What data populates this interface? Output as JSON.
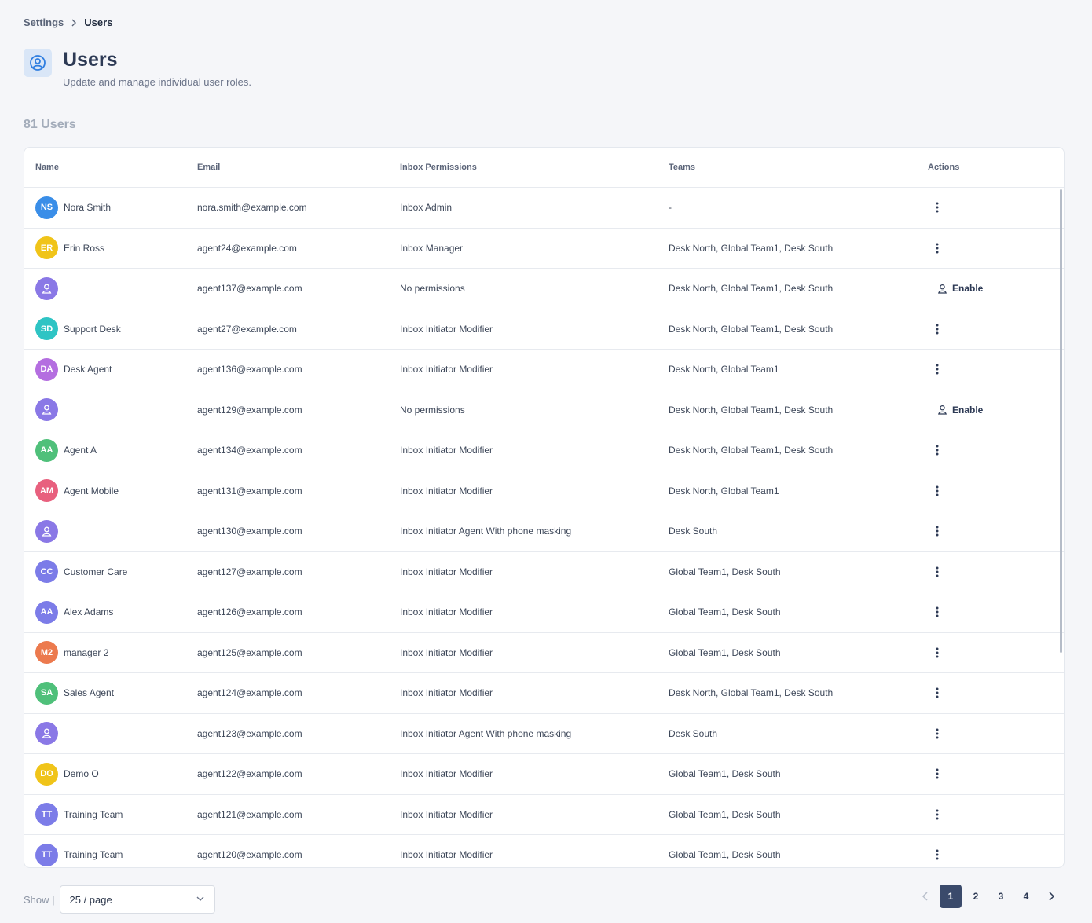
{
  "breadcrumb": {
    "parent": "Settings",
    "current": "Users"
  },
  "header": {
    "title": "Users",
    "subtitle": "Update and manage individual user roles."
  },
  "user_count": "81 Users",
  "columns": {
    "name": "Name",
    "email": "Email",
    "permissions": "Inbox Permissions",
    "teams": "Teams",
    "actions": "Actions"
  },
  "enable_label": "Enable",
  "rows": [
    {
      "initials": "NS",
      "color": "#3a8ee8",
      "name": "Nora Smith",
      "email": "nora.smith@example.com",
      "permission": "Inbox Admin",
      "teams": "-",
      "action": "menu"
    },
    {
      "initials": "ER",
      "color": "#f0c419",
      "name": "Erin Ross",
      "email": "agent24@example.com",
      "permission": "Inbox Manager",
      "teams": "Desk North,  Global Team1,  Desk South",
      "action": "menu"
    },
    {
      "initials": "",
      "color": "#8a78e6",
      "name": "",
      "email": "agent137@example.com",
      "permission": "No permissions",
      "teams": "Desk North,  Global Team1,  Desk South",
      "action": "enable"
    },
    {
      "initials": "SD",
      "color": "#2ec4c4",
      "name": "Support Desk",
      "email": "agent27@example.com",
      "permission": "Inbox Initiator Modifier",
      "teams": "Desk North,  Global Team1,  Desk South",
      "action": "menu"
    },
    {
      "initials": "DA",
      "color": "#b46ee0",
      "name": "Desk Agent",
      "email": "agent136@example.com",
      "permission": "Inbox Initiator Modifier",
      "teams": "Desk North,  Global Team1",
      "action": "menu"
    },
    {
      "initials": "",
      "color": "#8a78e6",
      "name": "",
      "email": "agent129@example.com",
      "permission": "No permissions",
      "teams": "Desk North,  Global Team1,  Desk South",
      "action": "enable"
    },
    {
      "initials": "AA",
      "color": "#4fc07a",
      "name": "Agent A",
      "email": "agent134@example.com",
      "permission": "Inbox Initiator Modifier",
      "teams": "Desk North,  Global Team1,  Desk South",
      "action": "menu"
    },
    {
      "initials": "AM",
      "color": "#e8607e",
      "name": "Agent Mobile",
      "email": "agent131@example.com",
      "permission": "Inbox Initiator Modifier",
      "teams": "Desk North,  Global Team1",
      "action": "menu"
    },
    {
      "initials": "",
      "color": "#8a78e6",
      "name": "",
      "email": "agent130@example.com",
      "permission": "Inbox Initiator Agent With phone masking",
      "teams": "Desk South",
      "action": "menu"
    },
    {
      "initials": "CC",
      "color": "#7c7ce8",
      "name": "Customer Care",
      "email": "agent127@example.com",
      "permission": "Inbox Initiator Modifier",
      "teams": "Global Team1,  Desk South",
      "action": "menu"
    },
    {
      "initials": "AA",
      "color": "#7c7ce8",
      "name": "Alex Adams",
      "email": "agent126@example.com",
      "permission": "Inbox Initiator Modifier",
      "teams": "Global Team1,  Desk South",
      "action": "menu"
    },
    {
      "initials": "M2",
      "color": "#ec7a4e",
      "name": "manager 2",
      "email": "agent125@example.com",
      "permission": "Inbox Initiator Modifier",
      "teams": "Global Team1,  Desk South",
      "action": "menu"
    },
    {
      "initials": "SA",
      "color": "#4fc07a",
      "name": "Sales Agent",
      "email": "agent124@example.com",
      "permission": "Inbox Initiator Modifier",
      "teams": "Desk North,  Global Team1,  Desk South",
      "action": "menu"
    },
    {
      "initials": "",
      "color": "#8a78e6",
      "name": "",
      "email": "agent123@example.com",
      "permission": "Inbox Initiator Agent With phone masking",
      "teams": "Desk South",
      "action": "menu"
    },
    {
      "initials": "DO",
      "color": "#f0c419",
      "name": "Demo O",
      "email": "agent122@example.com",
      "permission": "Inbox Initiator Modifier",
      "teams": "Global Team1,  Desk South",
      "action": "menu"
    },
    {
      "initials": "TT",
      "color": "#7c7ce8",
      "name": "Training Team",
      "email": "agent121@example.com",
      "permission": "Inbox Initiator Modifier",
      "teams": "Global Team1,  Desk South",
      "action": "menu"
    },
    {
      "initials": "TT",
      "color": "#7c7ce8",
      "name": "Training Team",
      "email": "agent120@example.com",
      "permission": "Inbox Initiator Modifier",
      "teams": "Global Team1,  Desk South",
      "action": "menu"
    }
  ],
  "footer": {
    "show_label": "Show |",
    "page_size": "25 / page",
    "pages": [
      "1",
      "2",
      "3",
      "4"
    ],
    "current_page": "1"
  },
  "colors": {
    "accent": "#3a4a6b",
    "header_icon_bg": "#d9e6f7",
    "header_icon": "#2f7ee0"
  }
}
